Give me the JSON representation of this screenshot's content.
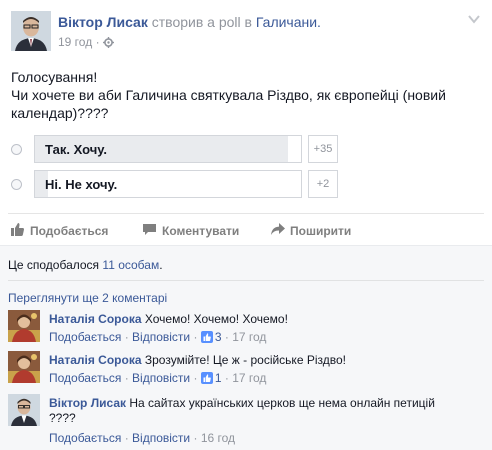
{
  "post": {
    "author": "Віктор Лисак",
    "action_text": "створив a poll в",
    "group": "Галичани.",
    "time": "19 год",
    "meta_sep": "·",
    "privacy_icon": "settings-gear-icon",
    "text_line1": "Голосування!",
    "text_line2": "Чи хочете ви аби Галичина святкувала Різдво, як європейці (новий календар)????"
  },
  "poll": {
    "options": [
      {
        "label": "Так. Хочу.",
        "count": "+35",
        "fill_fraction": 0.95
      },
      {
        "label": "Ні. Не хочу.",
        "count": "+2",
        "fill_fraction": 0.05
      }
    ]
  },
  "actions": {
    "like": "Подобається",
    "comment": "Коментувати",
    "share": "Поширити"
  },
  "likes": {
    "prefix": "Це сподобалося",
    "count_link": "11 особам",
    "suffix": "."
  },
  "more_comments": "Переглянути ще 2 коментарі",
  "comments": [
    {
      "name": "Наталія Сорока",
      "text": "Хочемо! Хочемо! Хочемо!",
      "like": "Подобається",
      "reply": "Відповісти",
      "likes_count": "3",
      "time": "17 год"
    },
    {
      "name": "Наталія Сорока",
      "text": "Зрозумійте! Це ж - російське Різдво!",
      "like": "Подобається",
      "reply": "Відповісти",
      "likes_count": "1",
      "time": "17 год"
    },
    {
      "name": "Віктор Лисак",
      "text": "На сайтах українських церков ще нема онлайн петицій",
      "text_line2": "????",
      "like": "Подобається",
      "reply": "Відповісти",
      "time": "16 год"
    }
  ],
  "sep": "·",
  "colors": {
    "link": "#3b5998",
    "muted": "#90949c",
    "poll_fill": "#e9ebee"
  }
}
